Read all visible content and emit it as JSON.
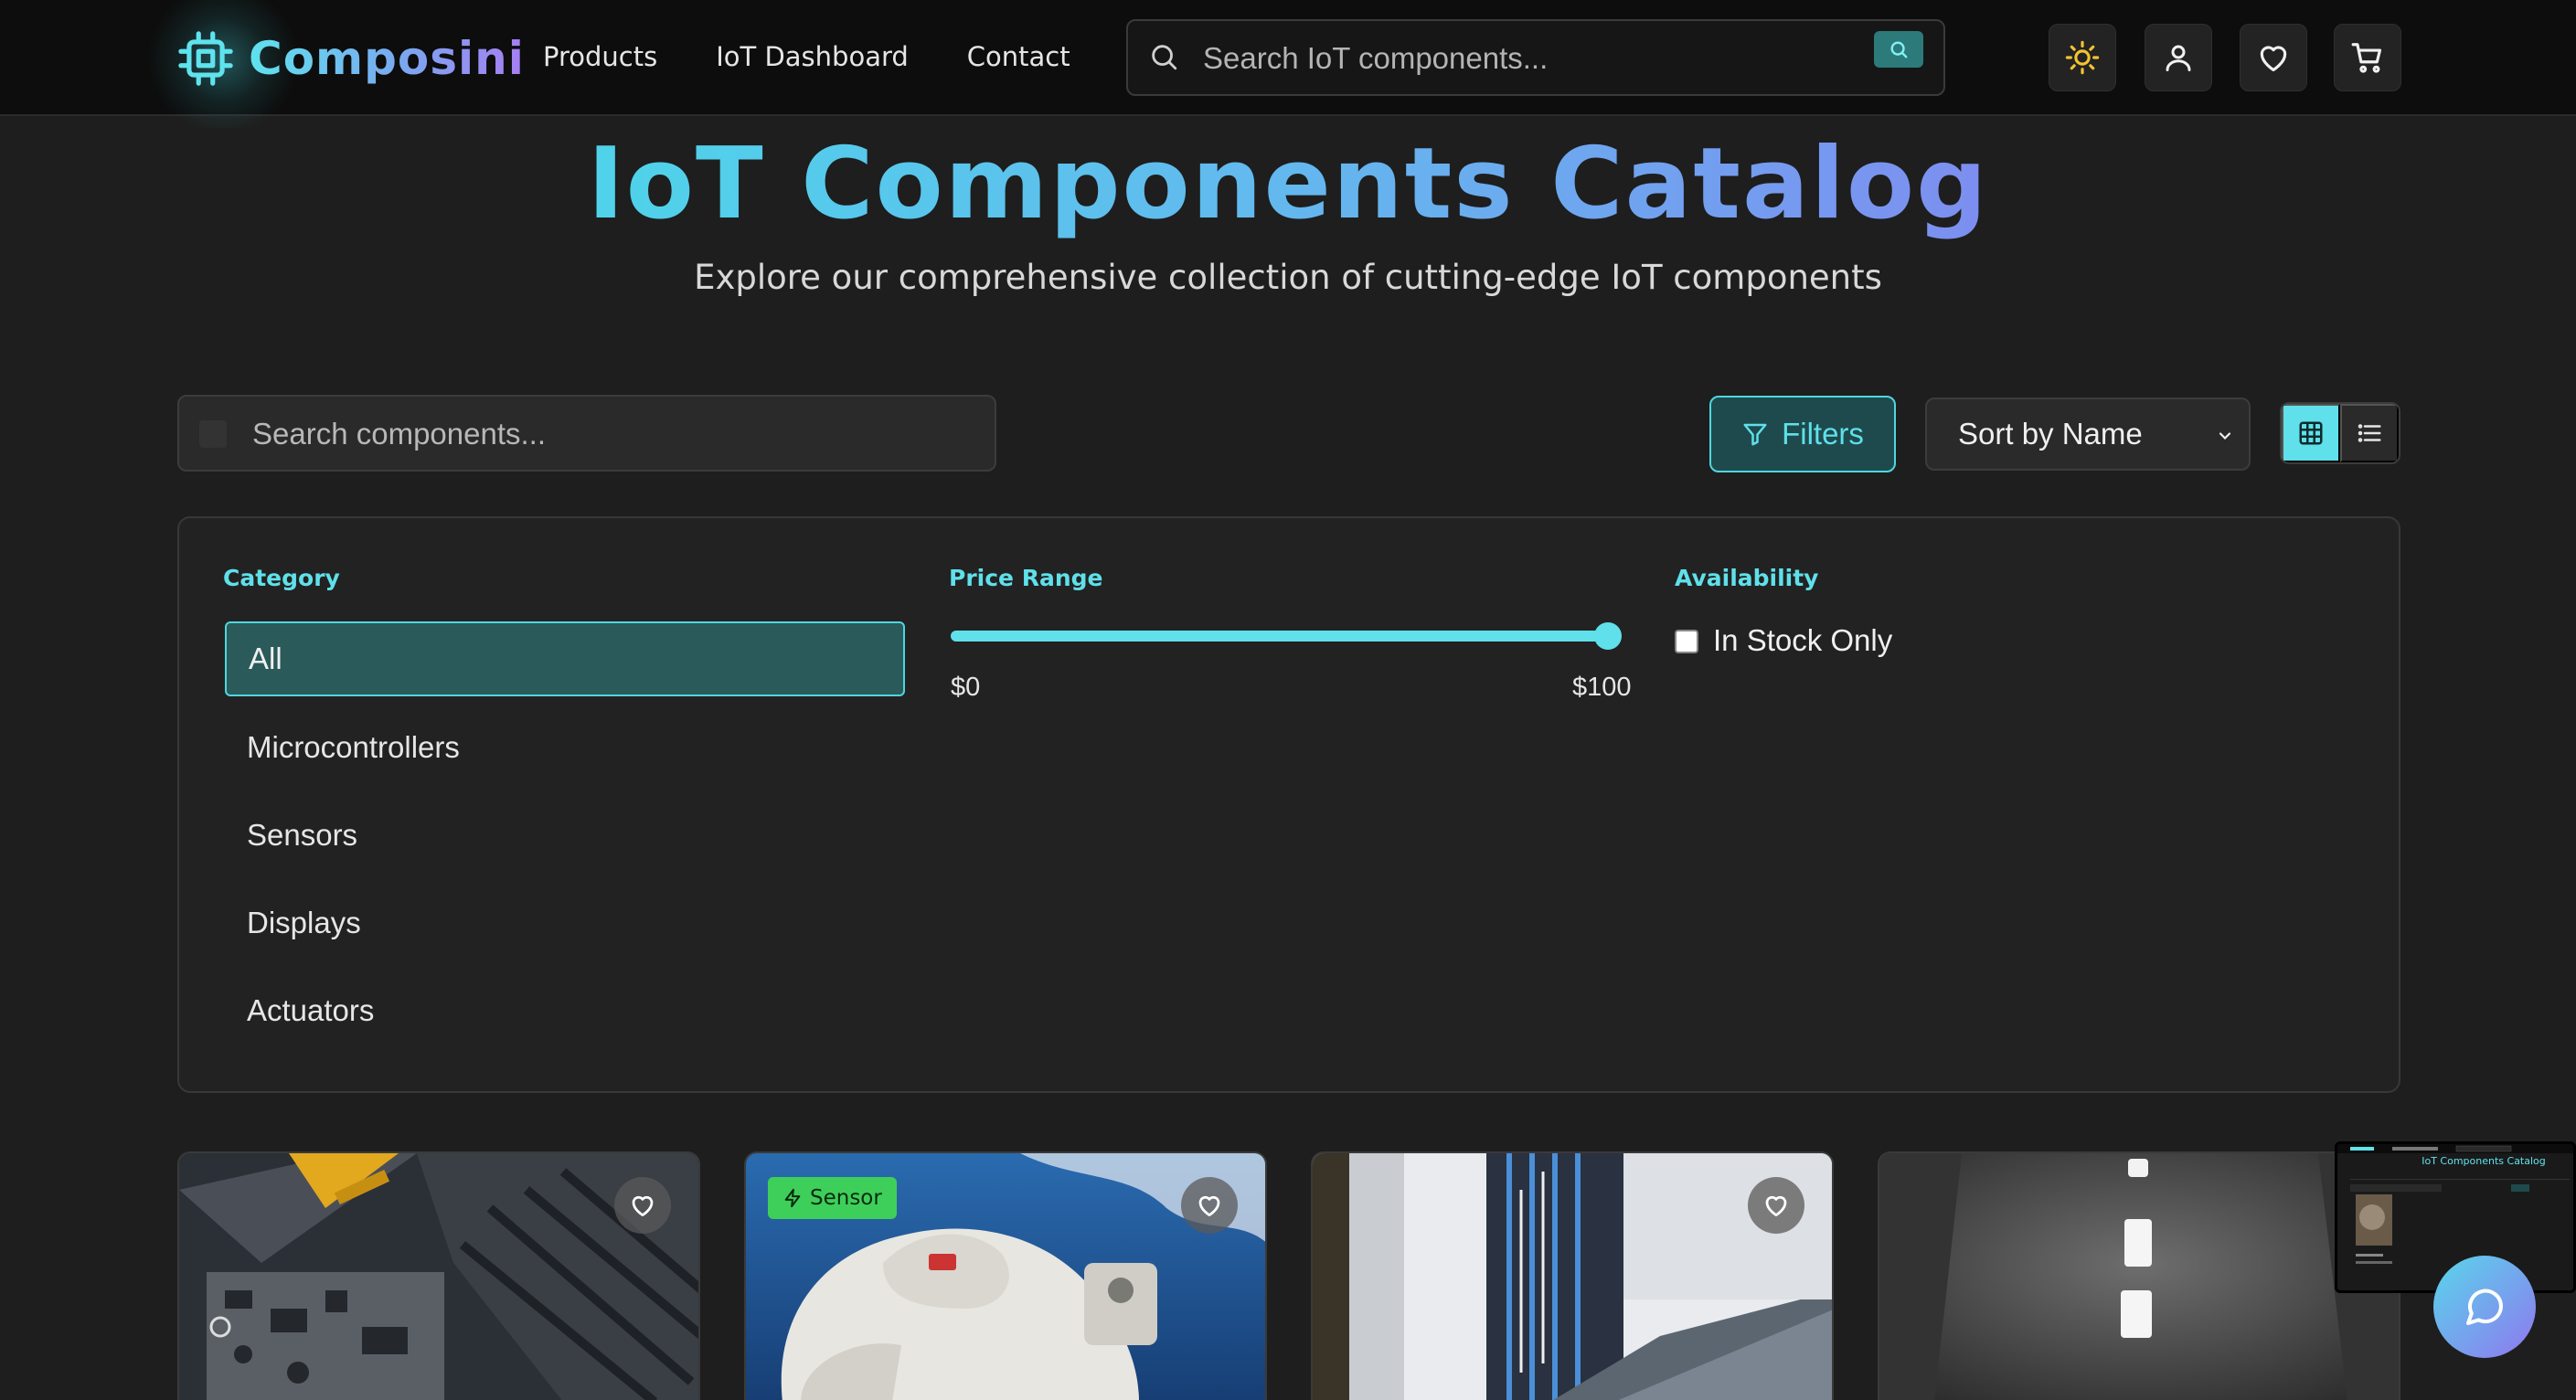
{
  "brand": {
    "name": "Composini"
  },
  "nav": {
    "links": [
      {
        "label": "Products"
      },
      {
        "label": "IoT Dashboard"
      },
      {
        "label": "Contact"
      }
    ],
    "search": {
      "placeholder": "Search IoT components..."
    },
    "icons": [
      "sun-icon",
      "user-icon",
      "heart-icon",
      "cart-icon"
    ]
  },
  "hero": {
    "title": "IoT Components Catalog",
    "subtitle": "Explore our comprehensive collection of cutting-edge IoT components"
  },
  "toolbar": {
    "search_placeholder": "Search components...",
    "filters_label": "Filters",
    "sort": {
      "selected": "Sort by Name"
    },
    "view_mode": "grid"
  },
  "filters": {
    "category": {
      "label": "Category",
      "items": [
        {
          "label": "All",
          "active": true
        },
        {
          "label": "Microcontrollers",
          "active": false
        },
        {
          "label": "Sensors",
          "active": false
        },
        {
          "label": "Displays",
          "active": false
        },
        {
          "label": "Actuators",
          "active": false
        }
      ]
    },
    "price": {
      "label": "Price Range",
      "min_label": "$0",
      "max_label": "$100",
      "value_fraction": 1.0
    },
    "availability": {
      "label": "Availability",
      "in_stock_label": "In Stock Only",
      "in_stock_checked": false
    }
  },
  "products": [
    {
      "badge": "",
      "image": "circuit-board-photo"
    },
    {
      "badge": "Sensor",
      "image": "astronaut-photo"
    },
    {
      "badge": "",
      "image": "server-rack-photo"
    },
    {
      "badge": "",
      "image": "corridor-photo"
    }
  ],
  "preview": {
    "title": "IoT Components Catalog"
  },
  "colors": {
    "accent": "#5fe0ea",
    "background": "#1e1e1e",
    "navbar": "#0d0d0d",
    "badge_green": "#3ecf5a"
  }
}
